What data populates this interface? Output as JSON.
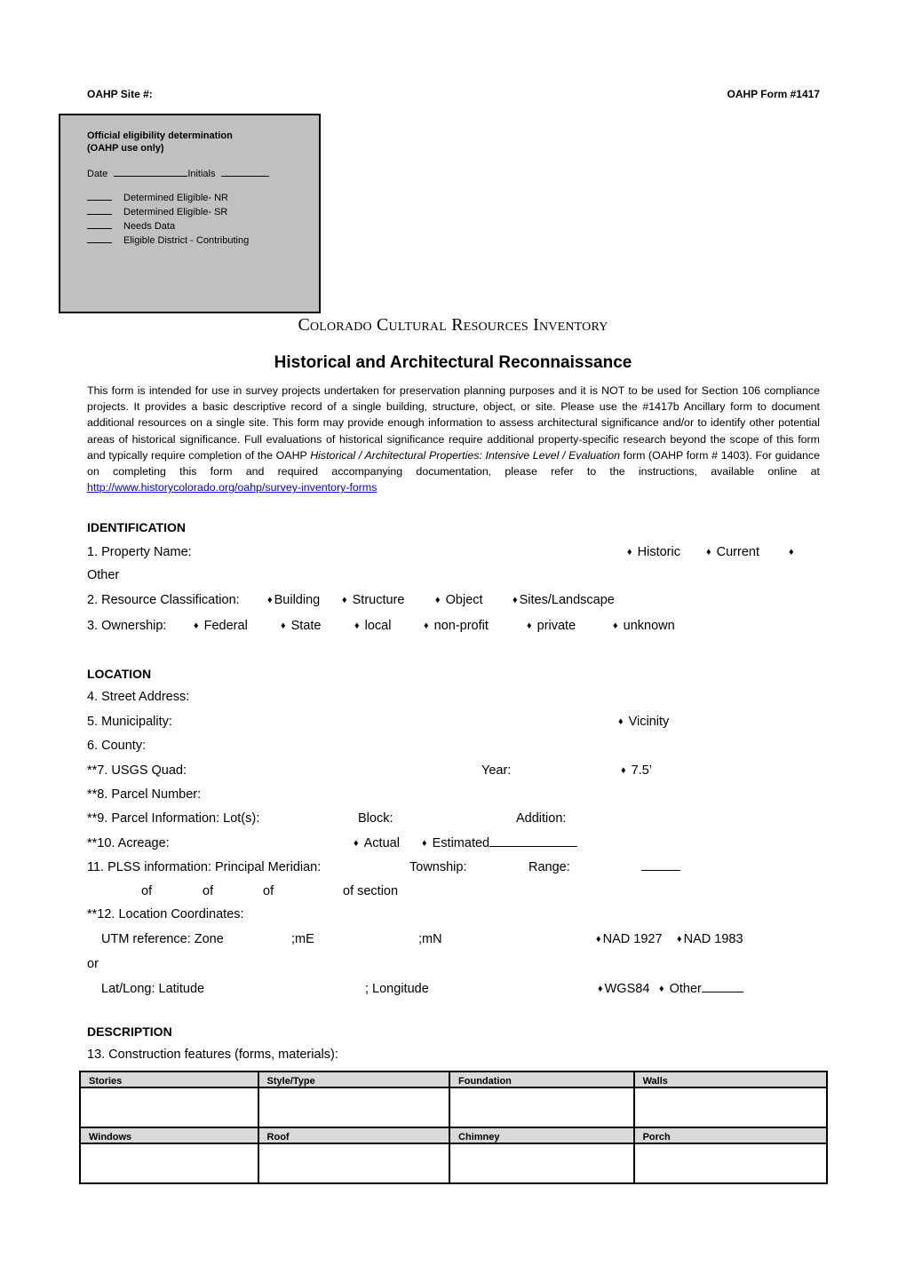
{
  "header": {
    "site_label": "OAHP Site #:",
    "form_label": "OAHP Form #1417"
  },
  "eligibility_box": {
    "title_line1": "Official eligibility determination",
    "title_line2": "(OAHP use only)",
    "date_label": "Date",
    "initials_label": "Initials",
    "options": [
      "Determined Eligible- NR",
      "Determined Eligible- SR",
      "Needs Data",
      "Eligible District - Contributing"
    ]
  },
  "titles": {
    "main": "Colorado Cultural Resources Inventory",
    "sub": "Historical and Architectural Reconnaissance"
  },
  "intro": {
    "text_a": "This form is intended for use in survey projects undertaken for preservation planning purposes and it is NOT to be used for Section 106 compliance projects. It provides a basic descriptive record of a single building, structure, object, or site.  Please use the #1417b Ancillary form to document additional resources on a single site. This form may provide enough information to assess architectural significance and/or to identify other potential areas of historical significance. Full evaluations of historical significance require additional property-specific research beyond the scope of this form and typically require completion of the OAHP ",
    "italic_a": "Historical / Architectural Properties: Intensive Level / Evaluation",
    "text_b": " form (OAHP form # 1403). For guidance on completing this form and required accompanying documentation, please refer to the instructions, available online at ",
    "link": "http://www.historycolorado.org/oahp/survey-inventory-forms"
  },
  "identification": {
    "heading": "IDENTIFICATION",
    "property_name": {
      "label": "1. Property Name:",
      "options": [
        "Historic",
        "Current",
        "Other"
      ]
    },
    "resource_classification": {
      "label": "2. Resource Classification:",
      "options": [
        "Building",
        "Structure",
        "Object",
        "Sites/Landscape"
      ]
    },
    "ownership": {
      "label": "3. Ownership:",
      "options": [
        "Federal",
        "State",
        "local",
        "non-profit",
        "private",
        "unknown"
      ]
    }
  },
  "location": {
    "heading": "LOCATION",
    "street_address": "4. Street Address:",
    "municipality": "5. Municipality:",
    "vicinity": "Vicinity",
    "county": "6. County:",
    "usgs_quad": "**7. USGS Quad:",
    "year": "Year:",
    "quad_scale": "7.5’",
    "parcel_number": "**8. Parcel Number:",
    "parcel_info": "**9. Parcel Information: Lot(s):",
    "block": "Block:",
    "addition": "Addition:",
    "acreage": "**10. Acreage:",
    "actual": "Actual",
    "estimated": "Estimated",
    "plss": "11. PLSS information: Principal Meridian:",
    "township": "Township:",
    "range": "Range:",
    "of": "of",
    "of_section": "of section",
    "coords": "**12. Location Coordinates:",
    "utm": "UTM reference: Zone",
    "me": ";mE",
    "mn": ";mN",
    "nad1927": "NAD 1927",
    "nad1983": "NAD 1983",
    "or": "or",
    "latlong": "Lat/Long: Latitude",
    "longitude": "; Longitude",
    "wgs84": "WGS84",
    "other": "Other"
  },
  "description": {
    "heading": "DESCRIPTION",
    "construction": "13. Construction features (forms, materials):",
    "table_rows": [
      [
        "Stories",
        "Style/Type",
        "Foundation",
        "Walls"
      ],
      [
        "Windows",
        "Roof",
        "Chimney",
        "Porch"
      ]
    ]
  }
}
